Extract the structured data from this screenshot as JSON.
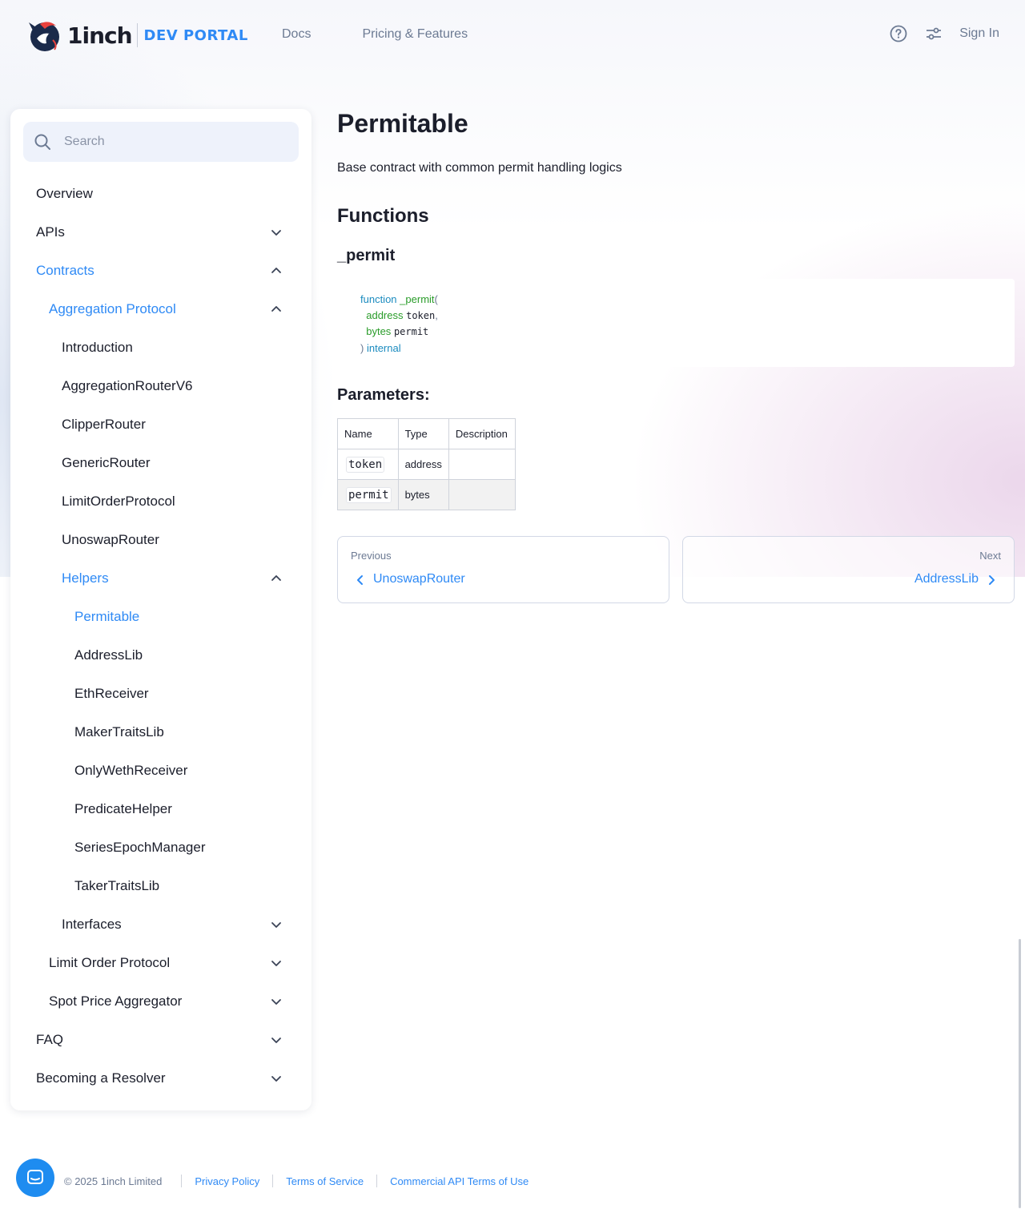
{
  "header": {
    "logo_word": "1inch",
    "logo_sub": "DEV PORTAL",
    "nav": [
      "Docs",
      "Pricing & Features"
    ],
    "sign_in": "Sign In"
  },
  "sidebar": {
    "search_placeholder": "Search",
    "items": [
      {
        "label": "Overview",
        "level": 0,
        "chevron": "none",
        "active": false
      },
      {
        "label": "APIs",
        "level": 0,
        "chevron": "down",
        "active": false
      },
      {
        "label": "Contracts",
        "level": 0,
        "chevron": "up",
        "active": true
      },
      {
        "label": "Aggregation Protocol",
        "level": 1,
        "chevron": "up",
        "active": true
      },
      {
        "label": "Introduction",
        "level": 2,
        "chevron": "none",
        "active": false
      },
      {
        "label": "AggregationRouterV6",
        "level": 2,
        "chevron": "none",
        "active": false
      },
      {
        "label": "ClipperRouter",
        "level": 2,
        "chevron": "none",
        "active": false
      },
      {
        "label": "GenericRouter",
        "level": 2,
        "chevron": "none",
        "active": false
      },
      {
        "label": "LimitOrderProtocol",
        "level": 2,
        "chevron": "none",
        "active": false
      },
      {
        "label": "UnoswapRouter",
        "level": 2,
        "chevron": "none",
        "active": false
      },
      {
        "label": "Helpers",
        "level": 2,
        "chevron": "up",
        "active": true
      },
      {
        "label": "Permitable",
        "level": 3,
        "chevron": "none",
        "active": true
      },
      {
        "label": "AddressLib",
        "level": 3,
        "chevron": "none",
        "active": false
      },
      {
        "label": "EthReceiver",
        "level": 3,
        "chevron": "none",
        "active": false
      },
      {
        "label": "MakerTraitsLib",
        "level": 3,
        "chevron": "none",
        "active": false
      },
      {
        "label": "OnlyWethReceiver",
        "level": 3,
        "chevron": "none",
        "active": false
      },
      {
        "label": "PredicateHelper",
        "level": 3,
        "chevron": "none",
        "active": false
      },
      {
        "label": "SeriesEpochManager",
        "level": 3,
        "chevron": "none",
        "active": false
      },
      {
        "label": "TakerTraitsLib",
        "level": 3,
        "chevron": "none",
        "active": false
      },
      {
        "label": "Interfaces",
        "level": 2,
        "chevron": "down",
        "active": false
      },
      {
        "label": "Limit Order Protocol",
        "level": 1,
        "chevron": "down",
        "active": false
      },
      {
        "label": "Spot Price Aggregator",
        "level": 1,
        "chevron": "down",
        "active": false
      },
      {
        "label": "FAQ",
        "level": 0,
        "chevron": "down",
        "active": false
      },
      {
        "label": "Becoming a Resolver",
        "level": 0,
        "chevron": "down",
        "active": false
      }
    ]
  },
  "main": {
    "title": "Permitable",
    "description": "Base contract with common permit handling logics",
    "functions_heading": "Functions",
    "function_name": "_permit",
    "code": {
      "keyword": "function",
      "fn": "_permit",
      "open": "(",
      "params": [
        {
          "type": "address",
          "name": "token",
          "sep": ","
        },
        {
          "type": "bytes",
          "name": "permit",
          "sep": ""
        }
      ],
      "close": ")",
      "visibility": "internal"
    },
    "parameters_heading": "Parameters:",
    "table": {
      "headers": [
        "Name",
        "Type",
        "Description"
      ],
      "rows": [
        {
          "name": "token",
          "type": "address",
          "description": ""
        },
        {
          "name": "permit",
          "type": "bytes",
          "description": ""
        }
      ]
    },
    "pager": {
      "prev_label": "Previous",
      "prev_title": "UnoswapRouter",
      "next_label": "Next",
      "next_title": "AddressLib"
    }
  },
  "footer": {
    "copyright": "© 2025 1inch Limited",
    "links": [
      "Privacy Policy",
      "Terms of Service",
      "Commercial API Terms of Use"
    ]
  },
  "colors": {
    "accent": "#2f8af5",
    "text": "#1b1e2b",
    "muted": "#6c7a93"
  }
}
